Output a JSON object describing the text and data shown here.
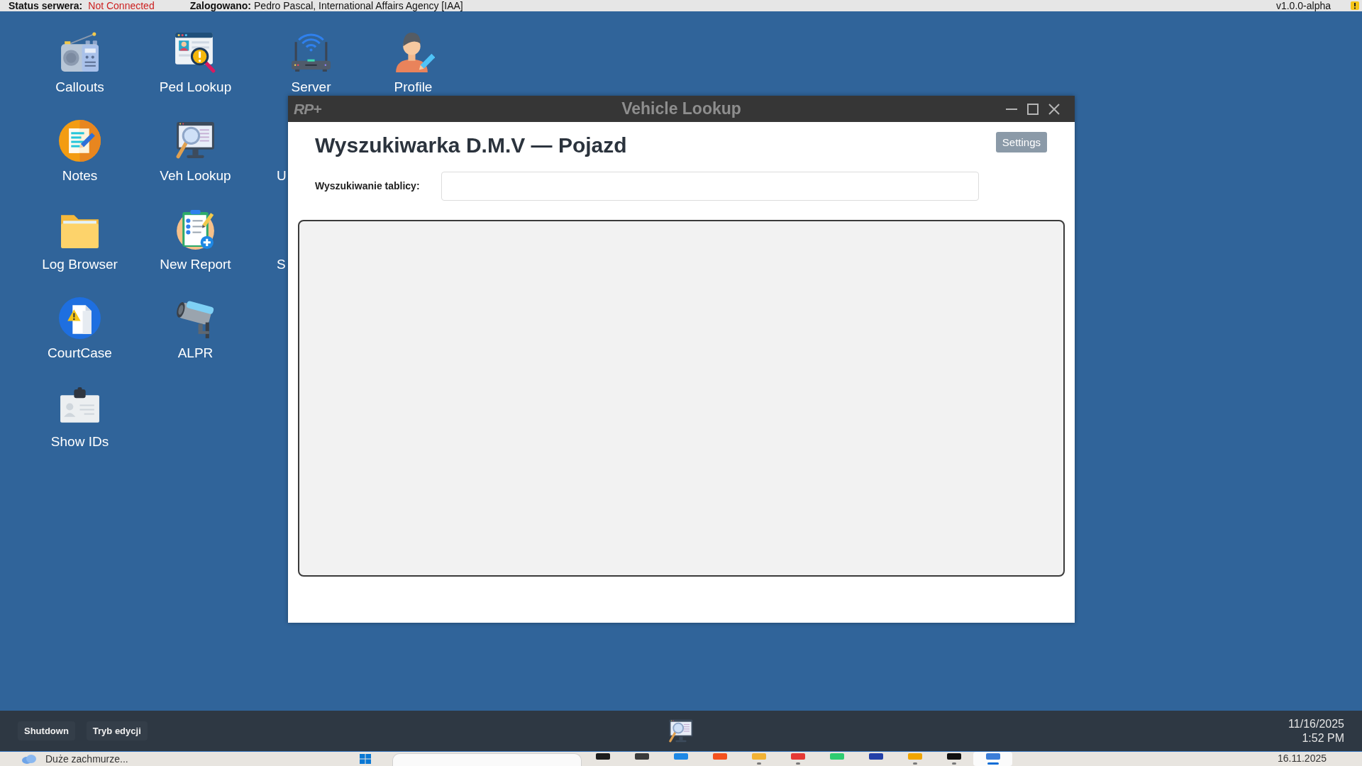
{
  "top_bar": {
    "server_status": {
      "label": "Status serwera:",
      "value": "Not Connected",
      "connected": false
    },
    "user": {
      "label": "Zalogowano:",
      "value": "Pedro Pascal, International Affairs Agency [IAA]"
    },
    "version": "v1.0.0-alpha"
  },
  "desktop": {
    "shortcut_rows": [
      [
        {
          "label": "Callouts",
          "kind": "radio"
        },
        {
          "label": "Ped Lookup",
          "kind": "ped_lookup"
        },
        {
          "label": "Server",
          "kind": "server"
        },
        {
          "label": "Profile",
          "kind": "profile"
        }
      ],
      [
        {
          "label": "Notes",
          "kind": "notes"
        },
        {
          "label": "Veh Lookup",
          "kind": "veh_lookup"
        },
        {
          "label": "U",
          "kind": "covered"
        }
      ],
      [
        {
          "label": "Log Browser",
          "kind": "folder"
        },
        {
          "label": "New Report",
          "kind": "report"
        },
        {
          "label": "S",
          "kind": "covered"
        }
      ],
      [
        {
          "label": "CourtCase",
          "kind": "court"
        },
        {
          "label": "ALPR",
          "kind": "camera"
        }
      ],
      [
        {
          "label": "Show IDs",
          "kind": "id_card"
        }
      ]
    ]
  },
  "window": {
    "logo": "RP+",
    "title": "Vehicle Lookup",
    "heading": "Wyszukiwarka D.M.V — Pojazd",
    "settings_button": "Settings",
    "plate_search": {
      "label": "Wyszukiwanie tablicy:"
    }
  },
  "taskbar": {
    "buttons": [
      "Shutdown",
      "Tryb edycji"
    ],
    "open_windows": [
      {
        "kind": "veh_lookup"
      }
    ],
    "date": "11/16/2025",
    "time": "1:52 PM"
  },
  "system_taskbar": {
    "weather": "Duże zachmurze...",
    "apps": [
      {
        "color": "#1c1c1c",
        "running": false,
        "selected": false
      },
      {
        "color": "#3a3a3a",
        "running": false,
        "selected": false
      },
      {
        "color": "#1e88e5",
        "running": false,
        "selected": false
      },
      {
        "color": "#f4511e",
        "running": false,
        "selected": false
      },
      {
        "color": "#f2b233",
        "running": true,
        "selected": false
      },
      {
        "color": "#e53935",
        "running": true,
        "selected": false
      },
      {
        "color": "#2ecc71",
        "running": false,
        "selected": false
      },
      {
        "color": "#2340a8",
        "running": false,
        "selected": false
      },
      {
        "color": "#f0a500",
        "running": true,
        "selected": false
      },
      {
        "color": "#111111",
        "running": true,
        "selected": false
      },
      {
        "color": "#3b7dd8",
        "running": true,
        "selected": true
      }
    ],
    "date": "16.11.2025"
  }
}
